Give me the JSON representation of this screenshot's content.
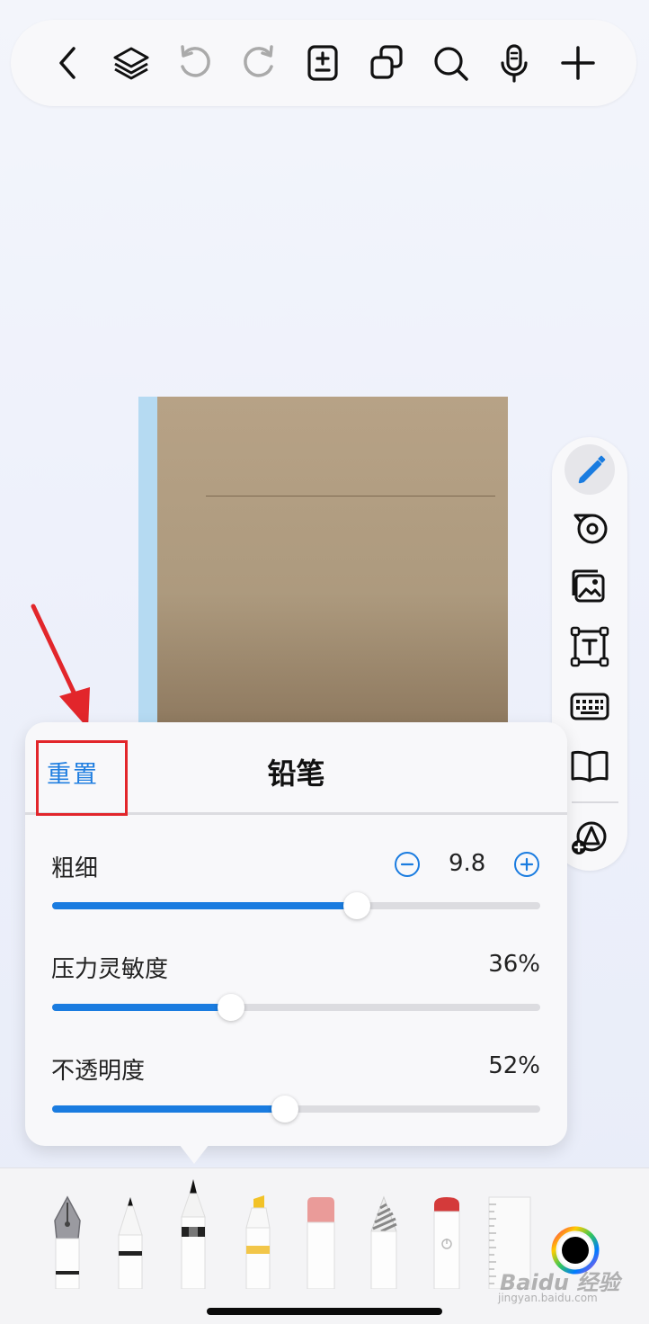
{
  "toolbar": {
    "icons": [
      "back-icon",
      "layers-icon",
      "undo-icon",
      "redo-icon",
      "page-add-icon",
      "copy-pages-icon",
      "search-icon",
      "microphone-icon",
      "add-icon"
    ]
  },
  "rail": {
    "icons": [
      "pencil-icon",
      "tape-icon",
      "image-icon",
      "text-box-icon",
      "keyboard-icon",
      "book-icon",
      "shapes-add-icon"
    ]
  },
  "popover": {
    "reset_label": "重置",
    "title": "铅笔",
    "thickness": {
      "label": "粗细",
      "value": "9.8",
      "fraction": 0.625
    },
    "pressure": {
      "label": "压力灵敏度",
      "value": "36%",
      "fraction": 0.366
    },
    "opacity": {
      "label": "不透明度",
      "value": "52%",
      "fraction": 0.477
    }
  },
  "tray": {
    "tools": [
      "fountain-pen",
      "ballpoint-pen",
      "pencil",
      "highlighter",
      "eraser",
      "pattern-pencil",
      "laser-pointer",
      "ruler",
      "color-wheel"
    ]
  },
  "colors": {
    "accent": "#1a7ce0",
    "highlight": "#e2262b",
    "notebook_cover": "#b09c80",
    "notebook_spine": "#b5daf2"
  },
  "watermark": {
    "brand": "Baidu 经验",
    "url": "jingyan.baidu.com"
  }
}
